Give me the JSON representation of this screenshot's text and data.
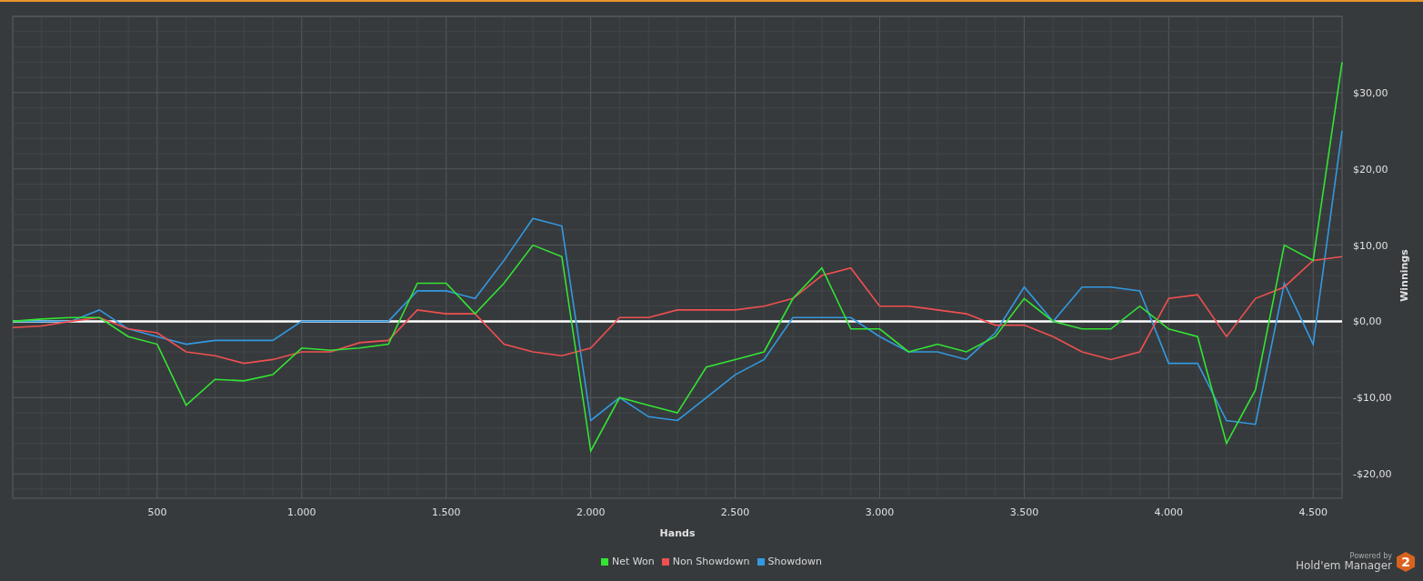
{
  "chart_data": {
    "type": "line",
    "grid": true,
    "xlabel": "Hands",
    "ylabel": "Winnings",
    "xlim": [
      0,
      4600
    ],
    "ylim": [
      -23.2,
      40
    ],
    "x": [
      0,
      100,
      200,
      300,
      400,
      500,
      600,
      700,
      800,
      900,
      1000,
      1100,
      1200,
      1300,
      1400,
      1500,
      1600,
      1700,
      1800,
      1900,
      2000,
      2100,
      2200,
      2300,
      2400,
      2500,
      2600,
      2700,
      2800,
      2900,
      3000,
      3100,
      3200,
      3300,
      3400,
      3500,
      3600,
      3700,
      3800,
      3900,
      4000,
      4100,
      4200,
      4300,
      4400,
      4500,
      4600
    ],
    "xticks": [
      {
        "value": 500,
        "label": "500"
      },
      {
        "value": 1000,
        "label": "1.000"
      },
      {
        "value": 1500,
        "label": "1.500"
      },
      {
        "value": 2000,
        "label": "2.000"
      },
      {
        "value": 2500,
        "label": "2.500"
      },
      {
        "value": 3000,
        "label": "3.000"
      },
      {
        "value": 3500,
        "label": "3.500"
      },
      {
        "value": 4000,
        "label": "4.000"
      },
      {
        "value": 4500,
        "label": "4.500"
      }
    ],
    "yticks": [
      {
        "value": -20,
        "label": "-$20,00"
      },
      {
        "value": -10,
        "label": "-$10,00"
      },
      {
        "value": 0,
        "label": "$0,00"
      },
      {
        "value": 10,
        "label": "$10,00"
      },
      {
        "value": 20,
        "label": "$20,00"
      },
      {
        "value": 30,
        "label": "$30,00"
      }
    ],
    "series": [
      {
        "name": "Net Won",
        "color": "#33e433",
        "values": [
          0,
          0.3,
          0.5,
          0.5,
          -2,
          -3,
          -11,
          -7.6,
          -7.8,
          -7,
          -3.5,
          -3.8,
          -3.5,
          -3,
          5,
          5,
          1,
          5,
          10,
          8.5,
          -17,
          -10,
          -11,
          -12,
          -6,
          -5,
          -4,
          3,
          7,
          -1,
          -1,
          -4,
          -3,
          -4,
          -2,
          3,
          0,
          -1,
          -1,
          2,
          -1,
          -2,
          -16,
          -9,
          10,
          8,
          34
        ]
      },
      {
        "name": "Non Showdown",
        "color": "#f05050",
        "values": [
          -0.8,
          -0.6,
          0,
          0.5,
          -1,
          -1.5,
          -4,
          -4.5,
          -5.5,
          -5,
          -4,
          -4,
          -2.8,
          -2.5,
          1.5,
          1,
          1,
          -3,
          -4,
          -4.5,
          -3.5,
          0.5,
          0.5,
          1.5,
          1.5,
          1.5,
          2,
          3,
          6,
          7,
          2,
          2,
          1.5,
          1,
          -0.5,
          -0.5,
          -2,
          -4,
          -5,
          -4,
          3,
          3.5,
          -2,
          3,
          4.5,
          8,
          8.5
        ]
      },
      {
        "name": "Showdown",
        "color": "#3399e0",
        "values": [
          0,
          0,
          0,
          1.5,
          -1,
          -2,
          -3,
          -2.5,
          -2.5,
          -2.5,
          0,
          0,
          0,
          0,
          4,
          4,
          3,
          8,
          13.5,
          12.5,
          -13,
          -10,
          -12.5,
          -13,
          -10,
          -7,
          -5,
          0.5,
          0.5,
          0.5,
          -2,
          -4,
          -4,
          -5,
          -1.5,
          4.5,
          0,
          4.5,
          4.5,
          4,
          -5.5,
          -5.5,
          -13,
          -13.5,
          5,
          -3,
          25
        ]
      }
    ]
  },
  "branding": {
    "caption": "Powered by",
    "product": "Hold'em Manager",
    "badge": "2"
  }
}
